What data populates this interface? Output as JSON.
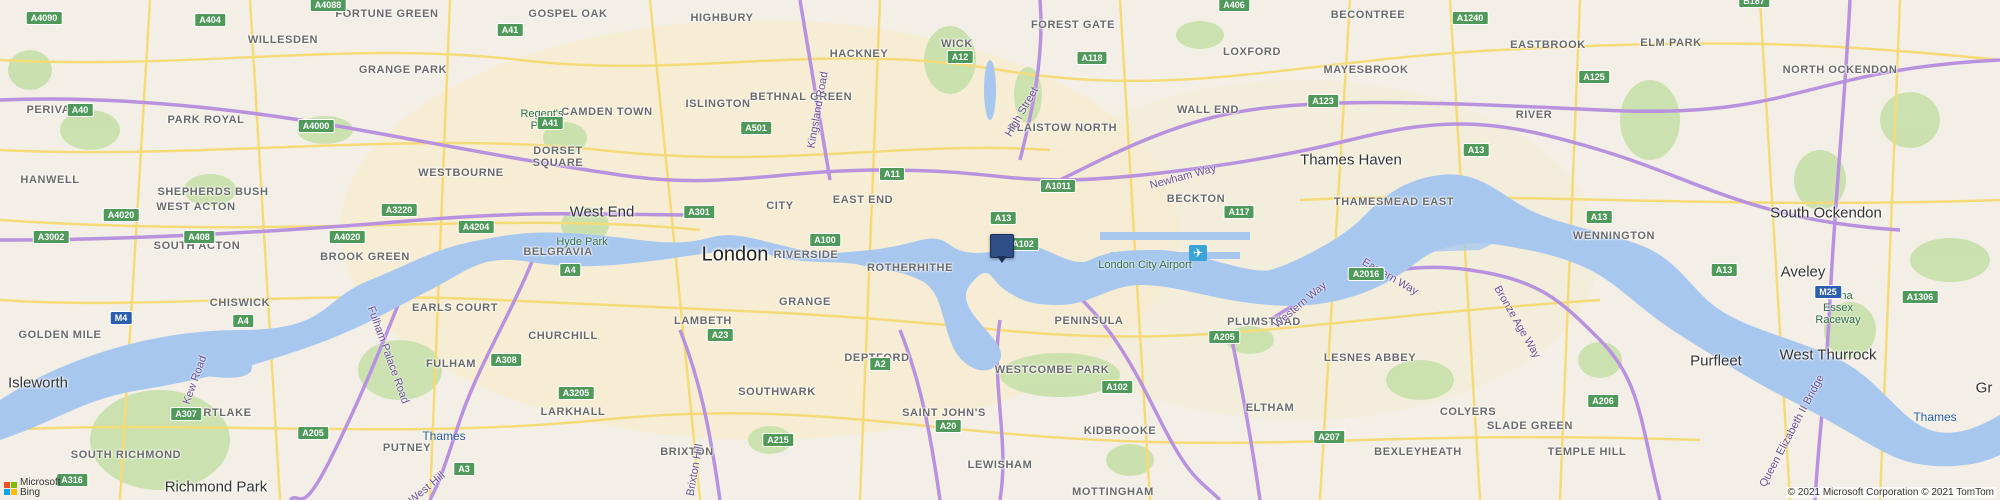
{
  "map": {
    "district_labels": [
      {
        "id": "fortune-green",
        "text": "FORTUNE GREEN"
      },
      {
        "id": "gospel-oak",
        "text": "GOSPEL OAK"
      },
      {
        "id": "highbury",
        "text": "HIGHBURY"
      },
      {
        "id": "willesden",
        "text": "WILLESDEN"
      },
      {
        "id": "camden-town",
        "text": "CAMDEN TOWN"
      },
      {
        "id": "grange-park",
        "text": "GRANGE PARK"
      },
      {
        "id": "perivale",
        "text": "PERIVALE"
      },
      {
        "id": "park-royal",
        "text": "PARK ROYAL"
      },
      {
        "id": "islington",
        "text": "ISLINGTON"
      },
      {
        "id": "hackney",
        "text": "HACKNEY"
      },
      {
        "id": "wick",
        "text": "WICK"
      },
      {
        "id": "forest-gate",
        "text": "FOREST GATE"
      },
      {
        "id": "becontree",
        "text": "BECONTREE"
      },
      {
        "id": "eastbrook",
        "text": "EASTBROOK"
      },
      {
        "id": "elm-park",
        "text": "ELM PARK"
      },
      {
        "id": "loxford",
        "text": "LOXFORD"
      },
      {
        "id": "mayesbrook",
        "text": "MAYESBROOK"
      },
      {
        "id": "north-ockendon",
        "text": "NORTH OCKENDON"
      },
      {
        "id": "bethnal-green",
        "text": "BETHNAL GREEN"
      },
      {
        "id": "plaistow-north",
        "text": "PLAISTOW NORTH"
      },
      {
        "id": "wall-end",
        "text": "WALL END"
      },
      {
        "id": "river",
        "text": "RIVER"
      },
      {
        "id": "hanwell",
        "text": "HANWELL"
      },
      {
        "id": "dorset-square",
        "text": "DORSET\nSQUARE"
      },
      {
        "id": "westbourne",
        "text": "WESTBOURNE"
      },
      {
        "id": "city",
        "text": "CITY"
      },
      {
        "id": "east-end",
        "text": "EAST END"
      },
      {
        "id": "beckton",
        "text": "BECKTON"
      },
      {
        "id": "west-acton",
        "text": "WEST ACTON"
      },
      {
        "id": "shepherds-bush",
        "text": "SHEPHERDS BUSH"
      },
      {
        "id": "south-acton",
        "text": "SOUTH ACTON"
      },
      {
        "id": "belgravia",
        "text": "BELGRAVIA"
      },
      {
        "id": "brook-green",
        "text": "BROOK GREEN"
      },
      {
        "id": "riverside",
        "text": "RIVERSIDE"
      },
      {
        "id": "rotherhithe",
        "text": "ROTHERHITHE"
      },
      {
        "id": "thamesmead-east",
        "text": "THAMESMEAD EAST"
      },
      {
        "id": "wennington",
        "text": "WENNINGTON"
      },
      {
        "id": "chiswick",
        "text": "CHISWICK"
      },
      {
        "id": "earls-court",
        "text": "EARLS COURT"
      },
      {
        "id": "grange",
        "text": "GRANGE"
      },
      {
        "id": "lambeth",
        "text": "LAMBETH"
      },
      {
        "id": "golden-mile",
        "text": "GOLDEN MILE"
      },
      {
        "id": "churchill",
        "text": "CHURCHILL"
      },
      {
        "id": "peninsula",
        "text": "PENINSULA"
      },
      {
        "id": "plumstead",
        "text": "PLUMSTEAD"
      },
      {
        "id": "fulham",
        "text": "FULHAM"
      },
      {
        "id": "deptford",
        "text": "DEPTFORD"
      },
      {
        "id": "westcombe-park",
        "text": "WESTCOMBE PARK"
      },
      {
        "id": "lesnes-abbey",
        "text": "LESNES ABBEY"
      },
      {
        "id": "mortlake",
        "text": "MORTLAKE"
      },
      {
        "id": "larkhall",
        "text": "LARKHALL"
      },
      {
        "id": "southwark",
        "text": "SOUTHWARK"
      },
      {
        "id": "saint-johns",
        "text": "SAINT JOHN'S"
      },
      {
        "id": "kidbrooke",
        "text": "KIDBROOKE"
      },
      {
        "id": "eltham",
        "text": "ELTHAM"
      },
      {
        "id": "colyers",
        "text": "COLYERS"
      },
      {
        "id": "slade-green",
        "text": "SLADE GREEN"
      },
      {
        "id": "putney",
        "text": "PUTNEY"
      },
      {
        "id": "brixton",
        "text": "BRIXTON"
      },
      {
        "id": "bexleyheath",
        "text": "BEXLEYHEATH"
      },
      {
        "id": "temple-hill",
        "text": "TEMPLE HILL"
      },
      {
        "id": "south-richmond",
        "text": "SOUTH RICHMOND"
      },
      {
        "id": "lewisham",
        "text": "LEWISHAM"
      },
      {
        "id": "mottingham",
        "text": "MOTTINGHAM"
      }
    ],
    "town_labels": [
      {
        "id": "west-end",
        "text": "West End"
      },
      {
        "id": "thames-haven",
        "text": "Thames Haven"
      },
      {
        "id": "south-ockendon",
        "text": "South Ockendon"
      },
      {
        "id": "aveley",
        "text": "Aveley"
      },
      {
        "id": "isleworth",
        "text": "Isleworth"
      },
      {
        "id": "purfleet",
        "text": "Purfleet"
      },
      {
        "id": "west-thurrock",
        "text": "West Thurrock"
      },
      {
        "id": "richmond-park",
        "text": "Richmond Park"
      },
      {
        "id": "gr",
        "text": "Gr"
      }
    ],
    "city_label": "London",
    "water_labels": [
      {
        "id": "thames-west",
        "text": "Thames"
      },
      {
        "id": "thames-east",
        "text": "Thames"
      }
    ],
    "poi_labels": [
      {
        "id": "regents-park",
        "text": "Regent's\nPark"
      },
      {
        "id": "hyde-park",
        "text": "Hyde Park"
      },
      {
        "id": "london-city-airport",
        "text": "London City Airport"
      },
      {
        "id": "arena-essex",
        "text": "Arena\nEssex\nRaceway"
      }
    ],
    "road_names": [
      {
        "id": "kingsland-road",
        "text": "Kingsland Road"
      },
      {
        "id": "high-street",
        "text": "High Street"
      },
      {
        "id": "newham-way",
        "text": "Newham Way"
      },
      {
        "id": "western-way",
        "text": "Western Way"
      },
      {
        "id": "eastern-way",
        "text": "Eastern Way"
      },
      {
        "id": "bronze-age-way",
        "text": "Bronze Age Way"
      },
      {
        "id": "fulham-palace-road",
        "text": "Fulham Palace Road"
      },
      {
        "id": "kew-road",
        "text": "Kew Road"
      },
      {
        "id": "west-hill",
        "text": "West Hill"
      },
      {
        "id": "queen-elizabeth-ii-bridge",
        "text": "Queen Elizabeth II Bridge"
      },
      {
        "id": "brixton-hill",
        "text": "Brixton Hill"
      }
    ],
    "road_shields": [
      {
        "id": "a4090",
        "text": "A4090"
      },
      {
        "id": "a404",
        "text": "A404"
      },
      {
        "id": "a4088",
        "text": "A4088"
      },
      {
        "id": "a41-n",
        "text": "A41"
      },
      {
        "id": "a41-s",
        "text": "A41"
      },
      {
        "id": "a40",
        "text": "A40"
      },
      {
        "id": "a4000",
        "text": "A4000"
      },
      {
        "id": "a501",
        "text": "A501"
      },
      {
        "id": "a12",
        "text": "A12"
      },
      {
        "id": "a118",
        "text": "A118"
      },
      {
        "id": "a406",
        "text": "A406"
      },
      {
        "id": "a1240",
        "text": "A1240"
      },
      {
        "id": "b187",
        "text": "B187"
      },
      {
        "id": "a125",
        "text": "A125"
      },
      {
        "id": "a123",
        "text": "A123"
      },
      {
        "id": "a13-w",
        "text": "A13"
      },
      {
        "id": "a11",
        "text": "A11"
      },
      {
        "id": "a1011",
        "text": "A1011"
      },
      {
        "id": "a3220",
        "text": "A3220"
      },
      {
        "id": "a4020-n",
        "text": "A4020"
      },
      {
        "id": "a301",
        "text": "A301"
      },
      {
        "id": "a13-c",
        "text": "A13"
      },
      {
        "id": "a117",
        "text": "A117"
      },
      {
        "id": "a13-e",
        "text": "A13"
      },
      {
        "id": "a3002",
        "text": "A3002"
      },
      {
        "id": "a408",
        "text": "A408"
      },
      {
        "id": "a4020-s",
        "text": "A4020"
      },
      {
        "id": "a4204",
        "text": "A4204"
      },
      {
        "id": "a100",
        "text": "A100"
      },
      {
        "id": "a102-n",
        "text": "A102"
      },
      {
        "id": "a4",
        "text": "A4"
      },
      {
        "id": "a2016",
        "text": "A2016"
      },
      {
        "id": "a13-far",
        "text": "A13"
      },
      {
        "id": "m4",
        "text": "M4"
      },
      {
        "id": "m25",
        "text": "M25"
      },
      {
        "id": "a1306",
        "text": "A1306"
      },
      {
        "id": "a4-w",
        "text": "A4"
      },
      {
        "id": "a23",
        "text": "A23"
      },
      {
        "id": "a205-n",
        "text": "A205"
      },
      {
        "id": "a308",
        "text": "A308"
      },
      {
        "id": "a2",
        "text": "A2"
      },
      {
        "id": "a307",
        "text": "A307"
      },
      {
        "id": "a3205",
        "text": "A3205"
      },
      {
        "id": "a102-s",
        "text": "A102"
      },
      {
        "id": "a206",
        "text": "A206"
      },
      {
        "id": "a205-w",
        "text": "A205"
      },
      {
        "id": "a215",
        "text": "A215"
      },
      {
        "id": "a20",
        "text": "A20"
      },
      {
        "id": "a207",
        "text": "A207"
      },
      {
        "id": "a3",
        "text": "A3"
      },
      {
        "id": "a316",
        "text": "A316"
      }
    ]
  },
  "branding": {
    "line1": "Microsoft",
    "line2": "Bing"
  },
  "copyright": "© 2021 Microsoft Corporation © 2021 TomTom",
  "colors": {
    "water": "#a8c8f0",
    "land": "#f2efe9",
    "major_road": "#b48fd6",
    "minor_road": "#f6e28c",
    "park": "#c8e3b0",
    "marker": "#2f4e86"
  }
}
